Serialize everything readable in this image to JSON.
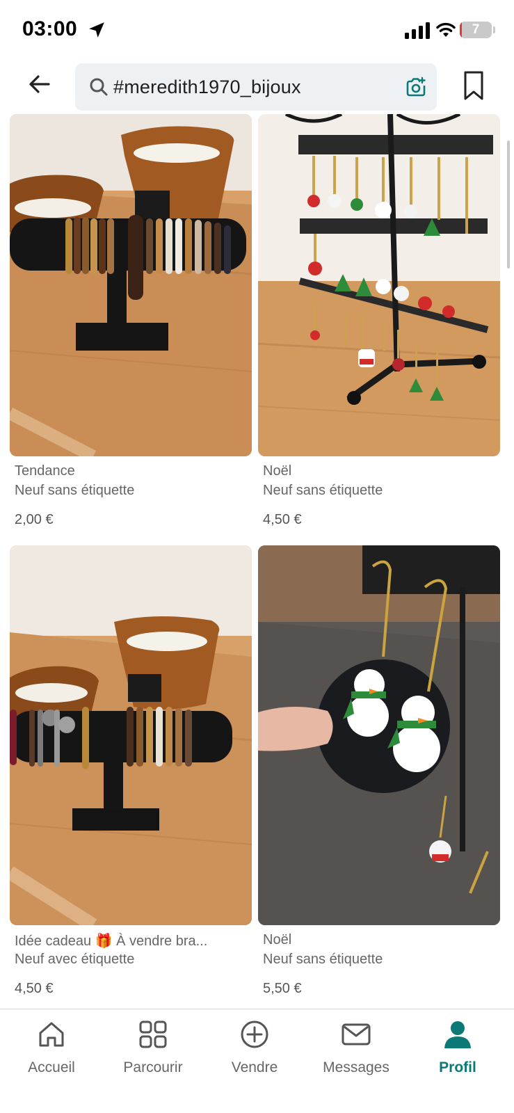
{
  "status_bar": {
    "time": "03:00",
    "battery_level": "7",
    "battery_percent": 7,
    "battery_color": "#e53935"
  },
  "header": {
    "back_icon": "arrow-left-icon",
    "search": {
      "value": "#meredith1970_bijoux",
      "icon": "search-icon",
      "camera_icon": "camera-search-icon"
    },
    "bookmark_icon": "bookmark-icon"
  },
  "listings": [
    {
      "title": "Tendance",
      "condition": "Neuf sans étiquette",
      "price": "2,00 €",
      "image": "bracelets-on-stand-photo"
    },
    {
      "title": "Noël",
      "condition": "Neuf sans étiquette",
      "price": "4,50 €",
      "image": "christmas-earrings-rack-photo"
    },
    {
      "title": "Idée cadeau 🎁  À vendre bra...",
      "condition": "Neuf avec étiquette",
      "price": "4,50 €",
      "image": "bracelets-gift-photo"
    },
    {
      "title": "Noël",
      "condition": "Neuf sans étiquette",
      "price": "5,50 €",
      "image": "snowman-earrings-photo"
    }
  ],
  "bottom_nav": {
    "items": [
      {
        "label": "Accueil",
        "icon": "home-icon",
        "active": false
      },
      {
        "label": "Parcourir",
        "icon": "grid-icon",
        "active": false
      },
      {
        "label": "Vendre",
        "icon": "plus-circle-icon",
        "active": false
      },
      {
        "label": "Messages",
        "icon": "mail-icon",
        "active": false
      },
      {
        "label": "Profil",
        "icon": "profile-icon",
        "active": true
      }
    ],
    "active_color": "#0b7a77"
  },
  "colors": {
    "accent": "#0b7a77",
    "search_bg": "#eef1f3"
  }
}
